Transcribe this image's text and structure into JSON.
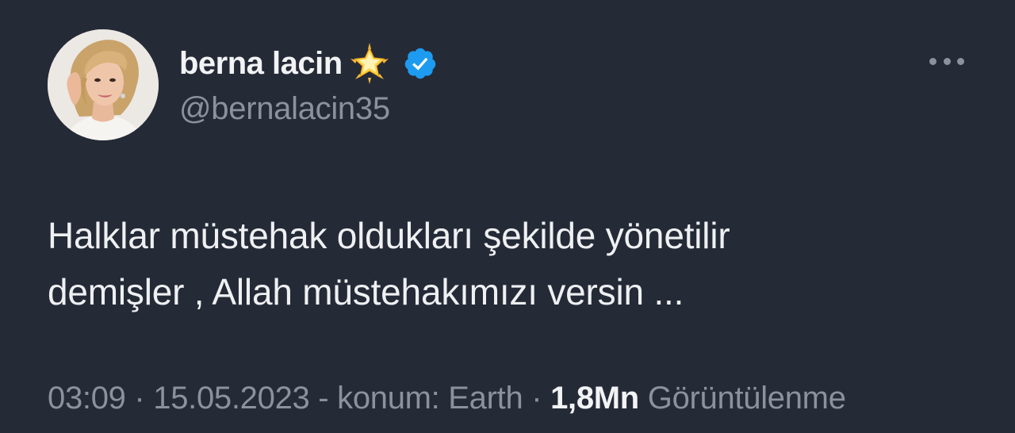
{
  "author": {
    "display_name": "berna lacin",
    "handle": "@bernalacin35",
    "name_emoji": "glowing-star-icon",
    "verified_icon": "verified-badge-icon",
    "verified_color": "#1d9bf0"
  },
  "tweet": {
    "text_lines": [
      "Halklar müstehak oldukları şekilde yönetilir",
      "demişler , Allah müstehakımızı versin ..."
    ]
  },
  "meta": {
    "time": "03:09",
    "separator_1": " · ",
    "date": "15.05.2023",
    "location_text": " - konum: Earth",
    "separator_2": " · ",
    "views_count": "1,8Mn",
    "views_label": " Görüntülenme"
  },
  "colors": {
    "background": "#252a37",
    "primary_text": "#eef0f2",
    "secondary_text": "#8b929b",
    "accent": "#1d9bf0"
  }
}
